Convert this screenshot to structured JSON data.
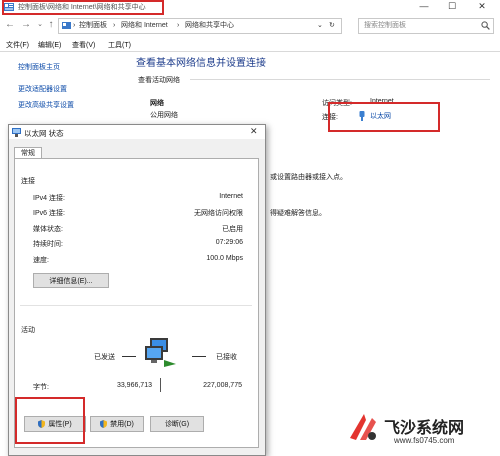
{
  "window": {
    "title": "控制面板\\网络和 Internet\\网络和共享中心",
    "controls": [
      "—",
      "☐",
      "✕"
    ]
  },
  "nav": {
    "address_parts": [
      "控制面板",
      "网络和 Internet",
      "网络和共享中心"
    ],
    "search_placeholder": "搜索控制面板"
  },
  "menu": [
    "文件(F)",
    "编辑(E)",
    "查看(V)",
    "工具(T)"
  ],
  "sidebar": {
    "items": [
      "控制面板主页",
      "更改适配器设置",
      "更改高级共享设置"
    ]
  },
  "main": {
    "heading": "查看基本网络信息并设置连接",
    "active_networks_label": "查看活动网络",
    "network_name": "网络",
    "network_type": "公用网络",
    "access_type_label": "访问类型:",
    "access_type_value": "Internet",
    "connection_label": "连接:",
    "connection_value": "以太网",
    "partial_text_1": "或设置路由器或接入点。",
    "partial_text_2": "得疑难解答信息。"
  },
  "dialog": {
    "title": "以太网 状态",
    "tab": "常规",
    "connection_section": "连接",
    "rows": [
      {
        "label": "IPv4 连接:",
        "value": "Internet"
      },
      {
        "label": "IPv6 连接:",
        "value": "无网络访问权限"
      },
      {
        "label": "媒体状态:",
        "value": "已启用"
      },
      {
        "label": "持续时间:",
        "value": "07:29:06"
      },
      {
        "label": "速度:",
        "value": "100.0 Mbps"
      }
    ],
    "details_button": "详细信息(E)...",
    "activity_section": "活动",
    "sent_label": "已发送",
    "received_label": "已接收",
    "bytes_label": "字节:",
    "bytes_sent": "33,966,713",
    "bytes_received": "227,008,775",
    "buttons": [
      "属性(P)",
      "禁用(D)",
      "诊断(G)"
    ]
  },
  "watermark": {
    "brand": "飞沙系统网",
    "url": "www.fs0745.com"
  },
  "colors": {
    "highlight_box": "#d42a2a",
    "link": "#0b4aa8",
    "heading": "#1e3d8c"
  }
}
